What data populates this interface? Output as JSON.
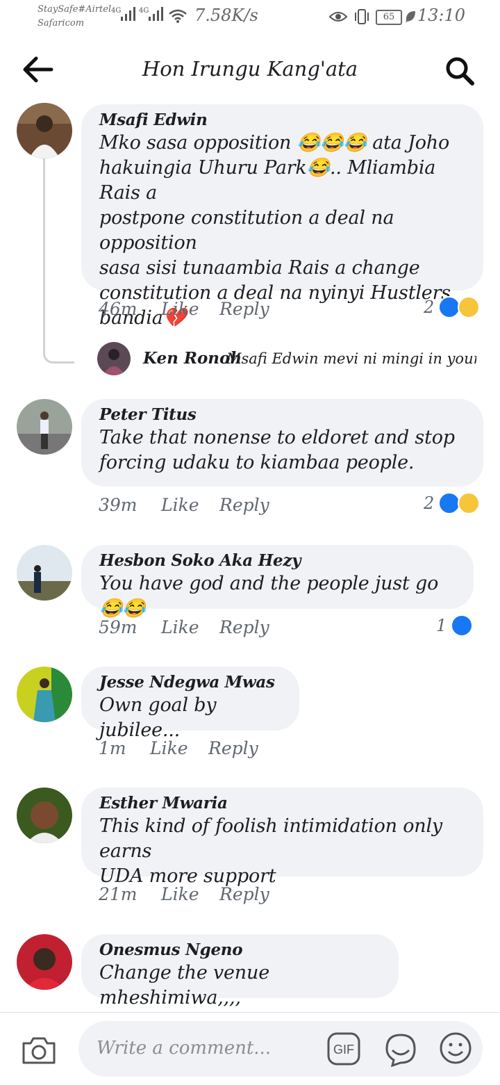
{
  "status_bar": {
    "carrier_line1": "StaySafe#Airtel",
    "carrier_line2": "Safaricom",
    "net1": "4G",
    "net2": "4G",
    "speed": "7.58K/s",
    "battery": "65",
    "time": "13:10"
  },
  "header": {
    "title": "Hon Irungu Kang'ata"
  },
  "comments": [
    {
      "name": "Msafi Edwin",
      "lines": [
        "Mko sasa opposition 😂😂😂 ata Joho",
        "hakuingia Uhuru Park😂.. Mliambia Rais a",
        "postpone constitution a deal na opposition",
        "sasa sisi tunaambia Rais a change",
        "constitution a deal na nyinyi Hustlers",
        "bandia💔"
      ],
      "time": "46m",
      "like": "Like",
      "reply": "Reply",
      "reactions": "2"
    },
    {
      "name": "Peter Titus",
      "lines": [
        "Take that nonense to eldoret and stop",
        "forcing udaku to kiambaa people."
      ],
      "time": "39m",
      "like": "Like",
      "reply": "Reply",
      "reactions": "2"
    },
    {
      "name": "Hesbon Soko Aka Hezy",
      "lines": [
        "You have god and the people just go😂😂"
      ],
      "time": "59m",
      "like": "Like",
      "reply": "Reply",
      "reactions": "1"
    },
    {
      "name": "Jesse Ndegwa Mwas",
      "lines": [
        "Own goal by jubilee..."
      ],
      "time": "1m",
      "like": "Like",
      "reply": "Reply"
    },
    {
      "name": "Esther Mwaria",
      "lines": [
        "This kind of foolish intimidation only earns",
        "UDA more support"
      ],
      "time": "21m",
      "like": "Like",
      "reply": "Reply"
    },
    {
      "name": "Onesmus Ngeno",
      "lines": [
        "Change the venue mheshimiwa,,,,"
      ]
    }
  ],
  "reply_preview": {
    "name": "Ken Ronoh",
    "text": "Msafi Edwin mevi ni mingi in your s..."
  },
  "composer": {
    "placeholder": "Write a comment...",
    "gif_label": "GIF"
  }
}
